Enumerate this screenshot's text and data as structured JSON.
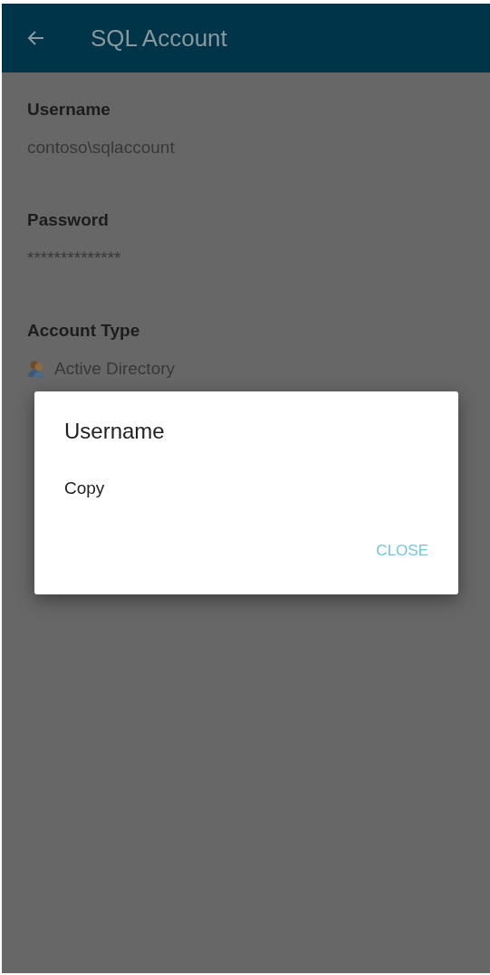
{
  "app_bar": {
    "title": "SQL Account"
  },
  "fields": [
    {
      "label": "Username",
      "value": "contoso\\sqlaccount",
      "kind": "text"
    },
    {
      "label": "Password",
      "value": "**************",
      "kind": "text"
    },
    {
      "label": "Account Type",
      "value": "Active Directory",
      "kind": "icon"
    }
  ],
  "dialog": {
    "title": "Username",
    "items": [
      "Copy"
    ],
    "button": "CLOSE"
  }
}
